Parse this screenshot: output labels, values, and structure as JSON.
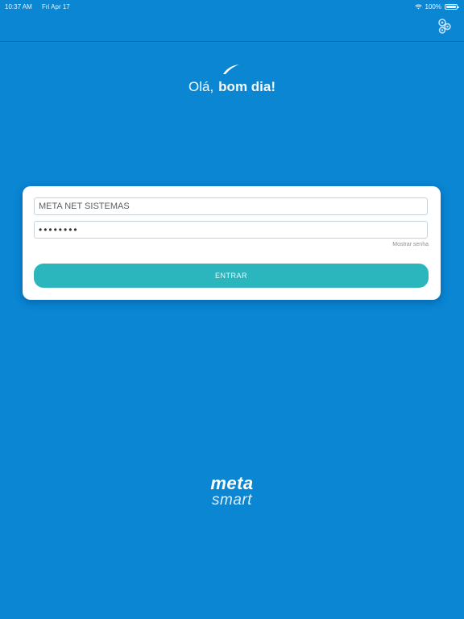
{
  "status_bar": {
    "time": "10:37 AM",
    "date": "Fri Apr 17",
    "battery": "100%"
  },
  "header": {
    "settings_icon": "gears-icon"
  },
  "greeting": {
    "hello": "Olá,",
    "good_day": "bom dia!"
  },
  "login": {
    "username_value": "META NET SISTEMAS",
    "password_value": "••••••••",
    "show_password_label": "Mostrar senha",
    "enter_label": "ENTRAR"
  },
  "logo": {
    "line1": "meta",
    "line2": "smart"
  },
  "colors": {
    "background": "#0A86D3",
    "button": "#2BB5BD",
    "card": "#FFFFFF"
  }
}
